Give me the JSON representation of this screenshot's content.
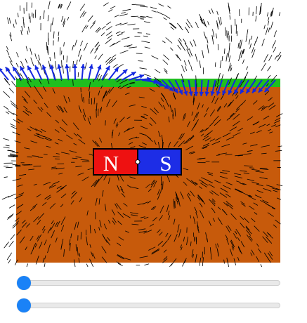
{
  "magnet": {
    "north_label": "N",
    "south_label": "S",
    "north_color": "#ee1111",
    "south_color": "#1d2de6"
  },
  "colors": {
    "soil": "#c75a0b",
    "grass": "#1fbf1f",
    "field_lines": "#000000",
    "surface_vectors": "#1428e0",
    "slider_thumb": "#1a82f7"
  },
  "controls": {
    "slider_1": {
      "value": 0.0,
      "icon": "slider-thumb"
    },
    "slider_2": {
      "value": 0.0,
      "icon": "slider-thumb"
    }
  }
}
